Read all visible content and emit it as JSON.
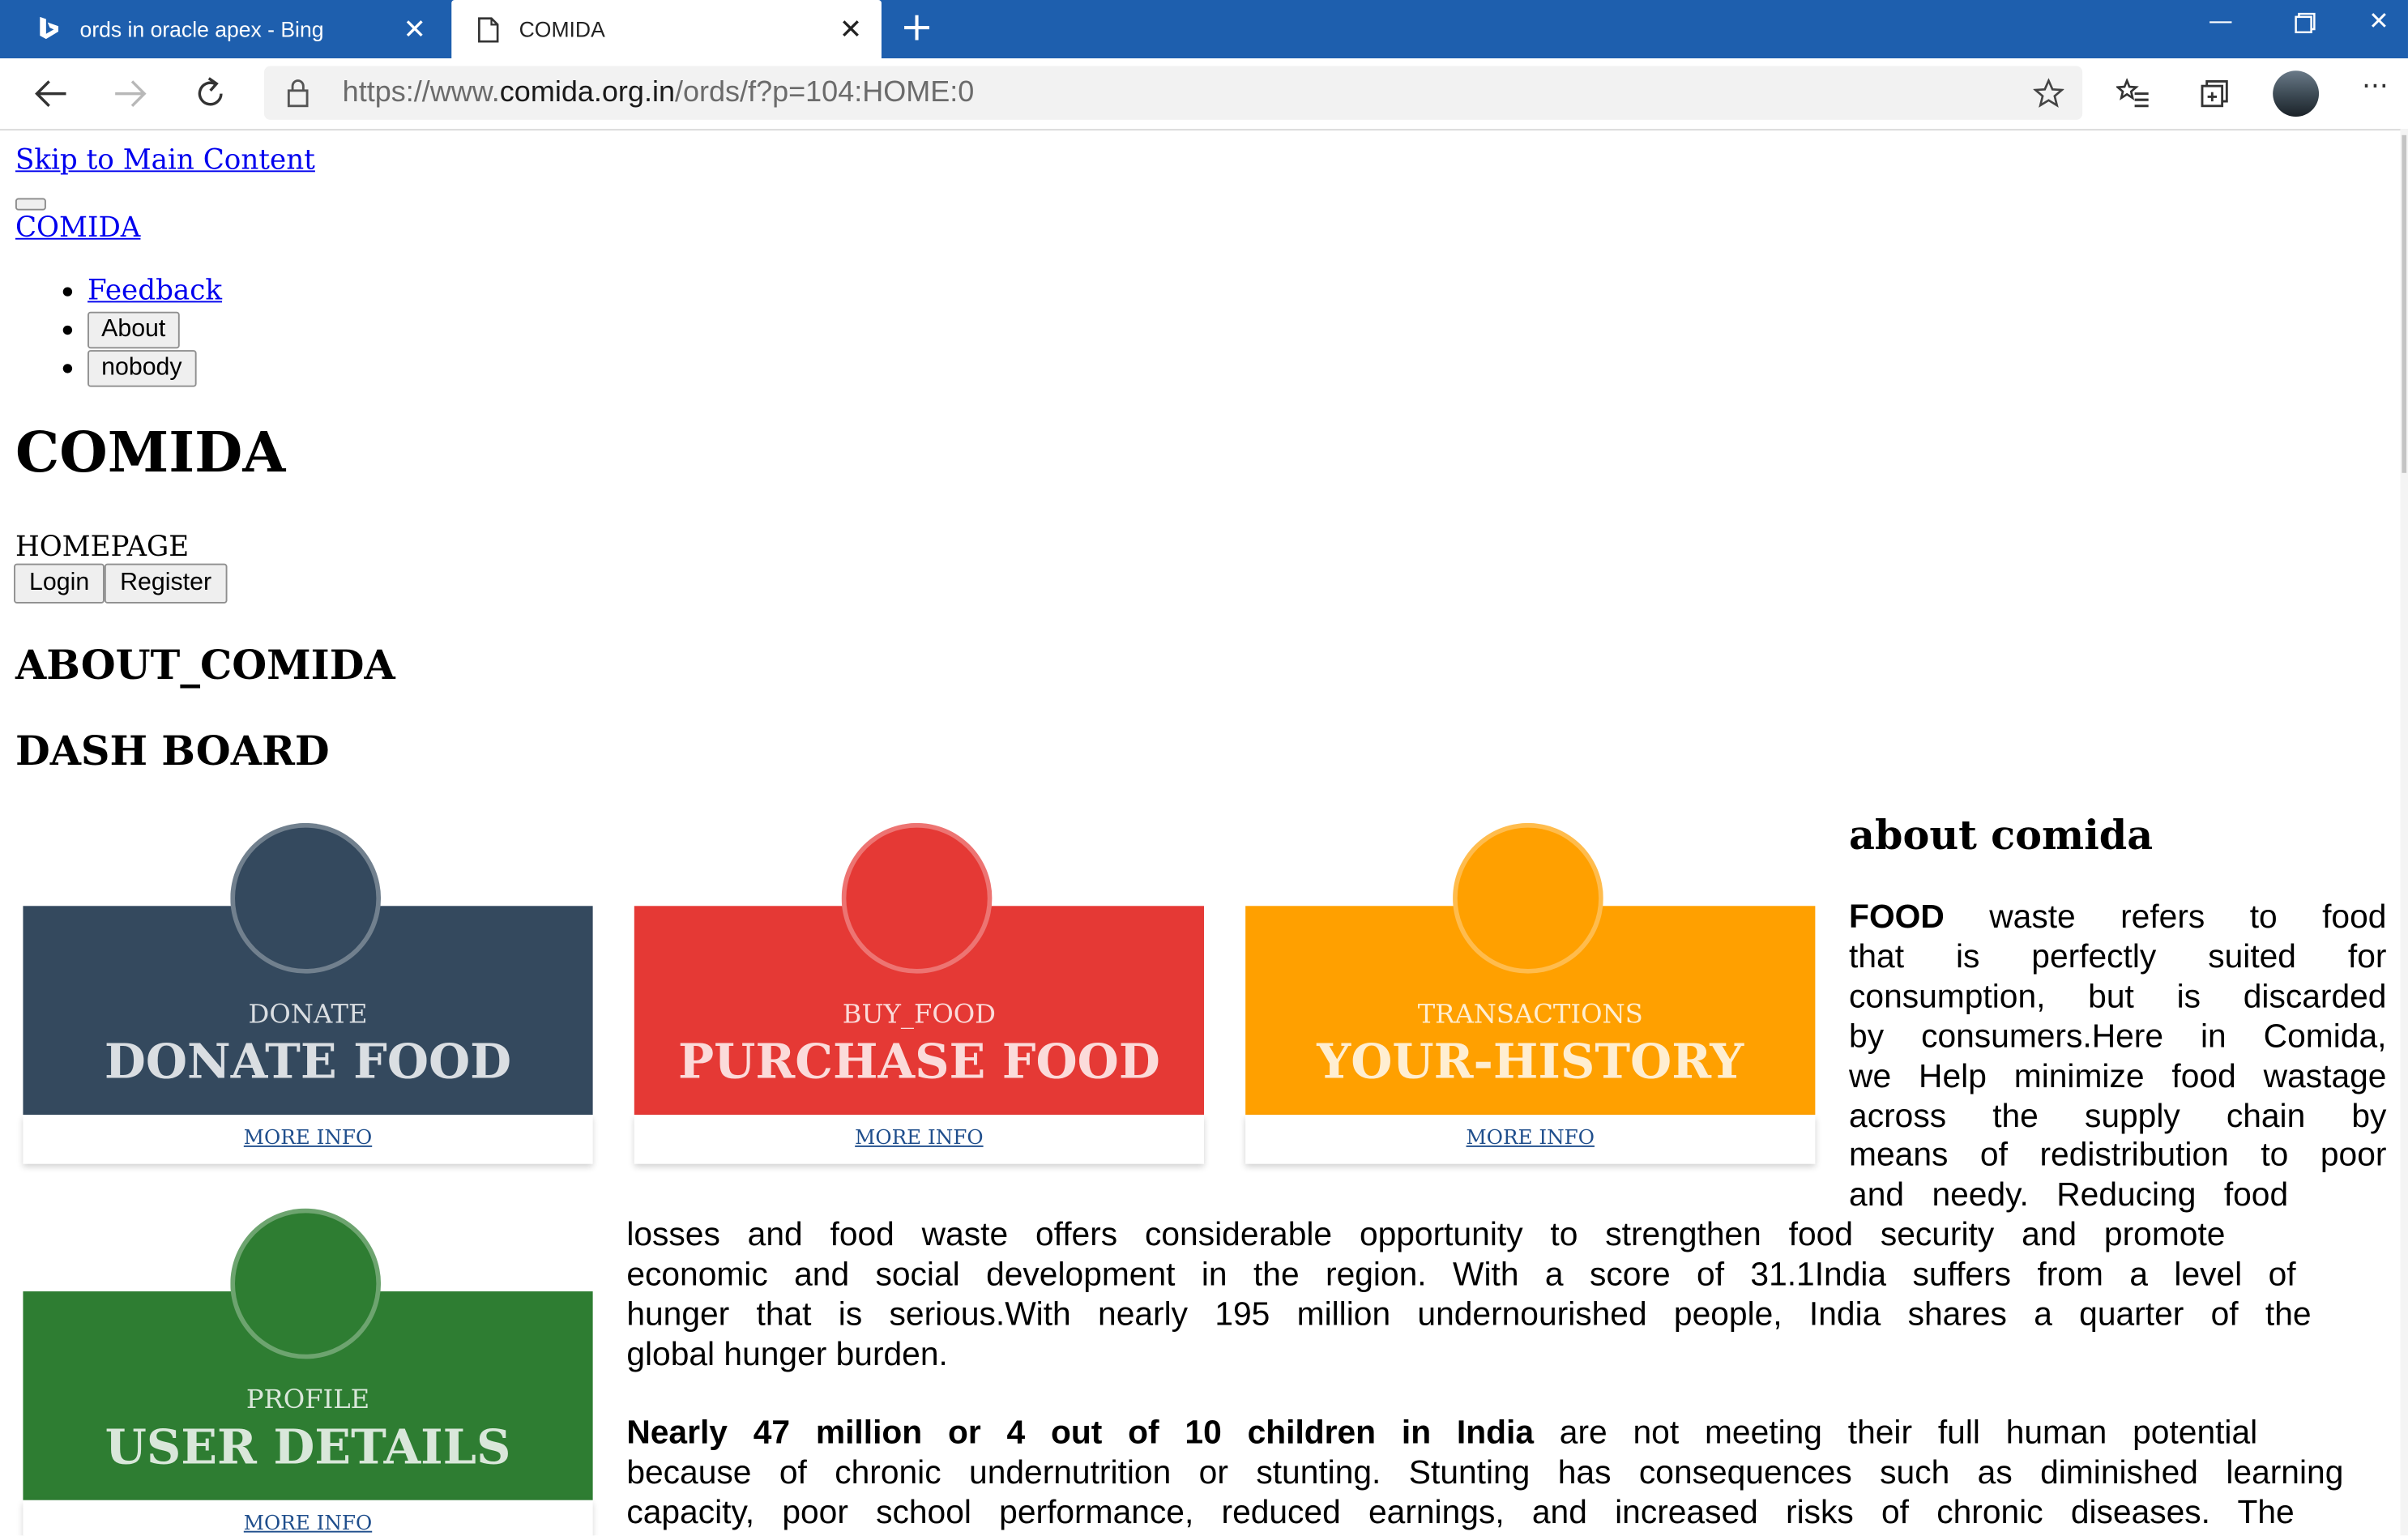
{
  "browser": {
    "tabs": [
      {
        "title": "ords in oracle apex - Bing",
        "icon": "bing-icon",
        "active": false
      },
      {
        "title": "COMIDA",
        "icon": "page-icon",
        "active": true
      }
    ],
    "url_prefix": "https://www.",
    "url_host": "comida.org.in",
    "url_path": "/ords/f?p=104:HOME:0",
    "accent": "#1e5fae"
  },
  "page": {
    "skip_link": "Skip to Main Content",
    "brand": "COMIDA",
    "nav": {
      "feedback": "Feedback",
      "about": "About",
      "user": "nobody"
    },
    "title": "COMIDA",
    "breadcrumb": "HOMEPAGE",
    "login": "Login",
    "register": "Register",
    "section_about": "ABOUT_COMIDA",
    "section_dashboard": "DASH BOARD"
  },
  "cards": [
    {
      "small": "DONATE",
      "big": "DONATE FOOD",
      "link": "MORE INFO",
      "color": "#34495e"
    },
    {
      "small": "BUY_FOOD",
      "big": "PURCHASE FOOD",
      "link": "MORE INFO",
      "color": "#e53935"
    },
    {
      "small": "TRANSACTIONS",
      "big": "YOUR-HISTORY",
      "link": "MORE INFO",
      "color": "#ffa000"
    },
    {
      "small": "PROFILE",
      "big": "USER DETAILS",
      "link": "MORE INFO",
      "color": "#2e7d32"
    }
  ],
  "about": {
    "heading": "about comida",
    "p1_bold": "FOOD",
    "p1_lines": [
      "waste refers to food",
      "that is perfectly suited for",
      "consumption, but is discarded",
      "by consumers.Here in Comida,",
      "we Help minimize food wastage",
      "across the supply chain by",
      "means of redistribution to poor",
      "and needy. Reducing food",
      "losses and food waste offers considerable opportunity to strengthen food security and promote",
      "economic and social development in the region. With a score of 31.1India suffers from a level of",
      "hunger that is serious.With nearly 195 million undernourished people, India shares a quarter of the",
      "global hunger burden."
    ],
    "p2_bold": "Nearly 47 million or 4 out of 10 children in India",
    "p2_lines": [
      "are not meeting their full human potential",
      "because of chronic undernutrition or stunting. Stunting has consequences such as diminished learning",
      "capacity, poor school performance, reduced earnings, and increased risks of chronic diseases. The"
    ]
  }
}
